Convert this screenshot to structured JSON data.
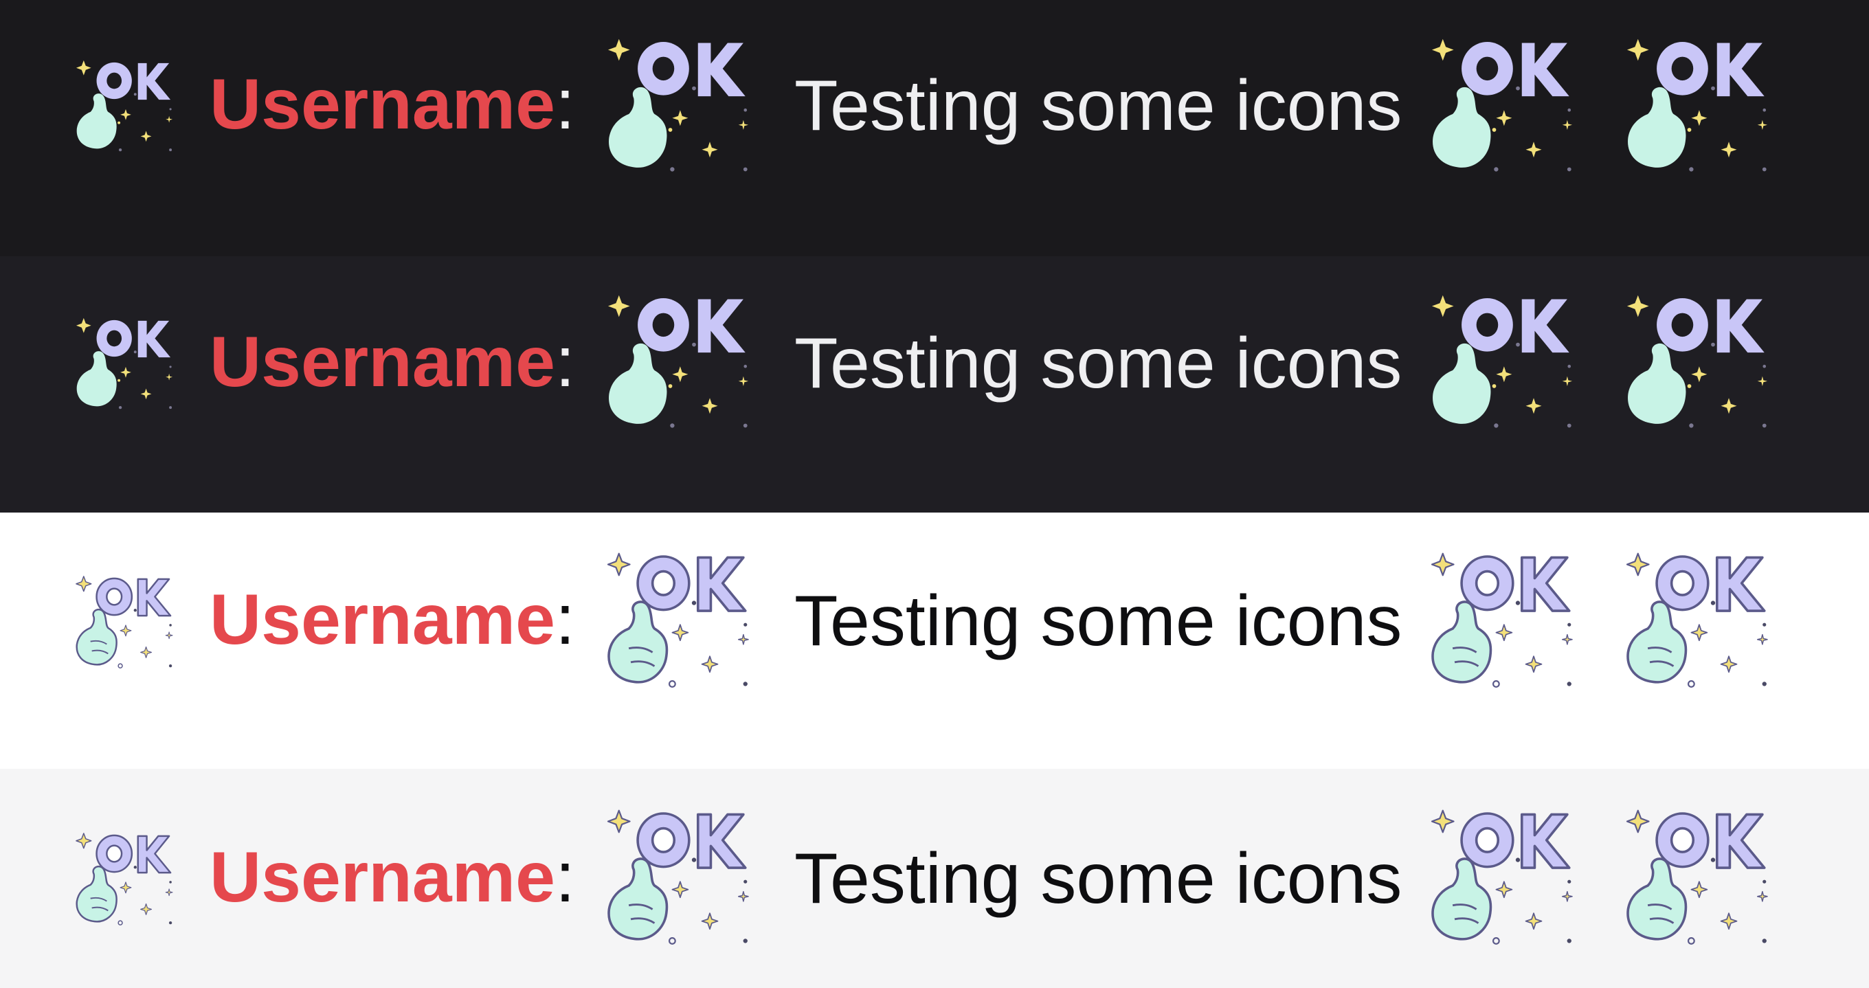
{
  "emote": {
    "name": "ok-hand-emote",
    "text": "OK"
  },
  "rows": [
    {
      "theme": "dark",
      "background": "#1a191c",
      "username": "Username",
      "separator": ":",
      "username_color": "#e5484d",
      "separator_color": "#efeff1",
      "message": "Testing some icons",
      "message_color": "#efeff1"
    },
    {
      "theme": "dark-alt",
      "background": "#1f1e23",
      "username": "Username",
      "separator": ":",
      "username_color": "#e5484d",
      "separator_color": "#efeff1",
      "message": "Testing some icons",
      "message_color": "#efeff1"
    },
    {
      "theme": "light",
      "background": "#ffffff",
      "username": "Username",
      "separator": ":",
      "username_color": "#e5484d",
      "separator_color": "#0e0e10",
      "message": "Testing some icons",
      "message_color": "#0e0e10"
    },
    {
      "theme": "light-alt",
      "background": "#f5f5f6",
      "username": "Username",
      "separator": ":",
      "username_color": "#e5484d",
      "separator_color": "#0e0e10",
      "message": "Testing some icons",
      "message_color": "#0e0e10"
    }
  ],
  "colors": {
    "emote_letters": "#c9c6f7",
    "emote_outline": "#5b5a8a",
    "emote_hand": "#c8f3e6",
    "emote_sparkle": "#f3e07a",
    "emote_dot_dark": "#7a7790",
    "emote_dot_light": "#4a4a66"
  }
}
